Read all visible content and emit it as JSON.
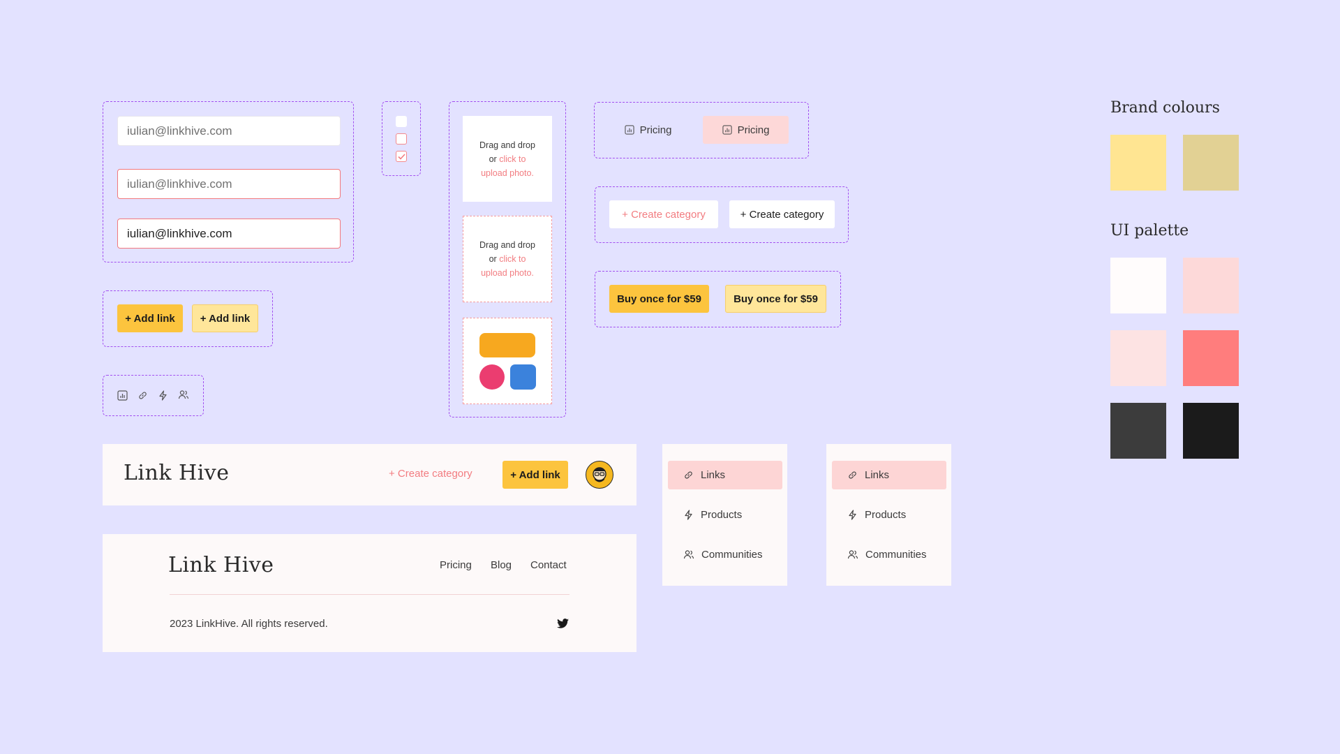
{
  "inputs": {
    "default": "iulian@linkhive.com",
    "error_placeholder": "iulian@linkhive.com",
    "error_filled": "iulian@linkhive.com"
  },
  "add_link": {
    "label": "+ Add link"
  },
  "upload": {
    "line1": "Drag and drop",
    "or": "or",
    "link1": "click to",
    "link2": "upload photo."
  },
  "pricing": {
    "label": "Pricing"
  },
  "create_category": {
    "label": "+ Create category"
  },
  "buy": {
    "label": "Buy once for $59"
  },
  "header": {
    "logo": "Link Hive",
    "create_category": "+ Create category",
    "add_link": "+ Add link"
  },
  "footer": {
    "logo": "Link Hive",
    "nav": [
      "Pricing",
      "Blog",
      "Contact"
    ],
    "copyright": "2023 LinkHive. All rights reserved."
  },
  "nav_menu": {
    "items": [
      {
        "label": "Links",
        "icon": "link-icon",
        "active": true
      },
      {
        "label": "Products",
        "icon": "lightning-icon"
      },
      {
        "label": "Communities",
        "icon": "users-icon"
      }
    ]
  },
  "palette": {
    "brand_title": "Brand colours",
    "ui_title": "UI palette",
    "brand": [
      "#ffe592",
      "#e2d194"
    ],
    "ui": [
      "#fffcfc",
      "#fdd9d9",
      "#fde3e3",
      "#ff7d7d",
      "#3c3c3c",
      "#1b1b1b"
    ]
  },
  "colors": {
    "background": "#e3e2ff",
    "accent_yellow": "#fcc43e",
    "accent_coral": "#f27c80",
    "dashed_border": "#a24ff0"
  }
}
